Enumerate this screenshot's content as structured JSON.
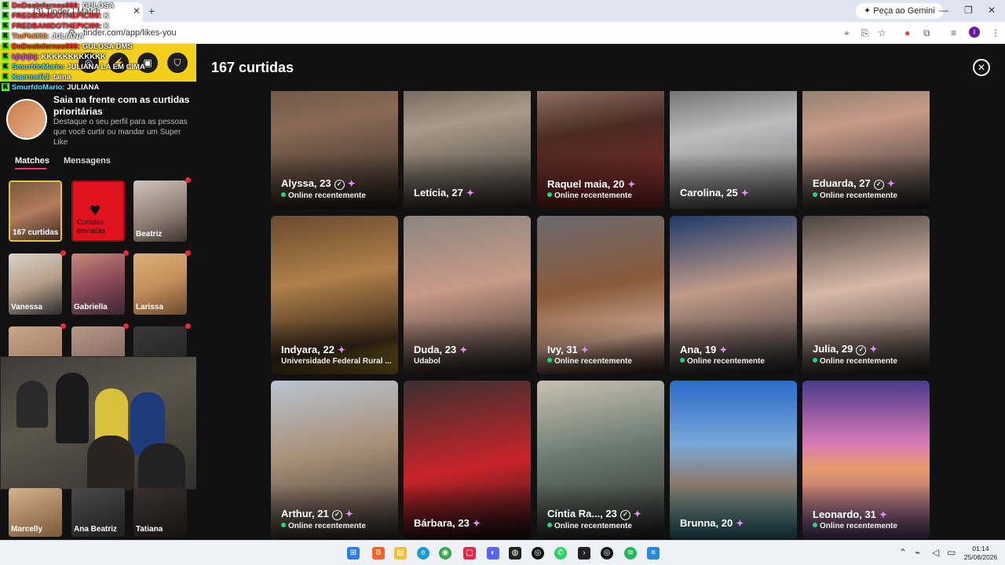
{
  "browser": {
    "tab_title": "(3) Tinder | Match",
    "url": "tinder.com/app/likes-you",
    "gemini_button": "Peça ao Gemini",
    "profile_initial": "I"
  },
  "chat": [
    {
      "user": "DnDosInfernos666:",
      "msg": "GULOSA",
      "color": "#ff2b2b"
    },
    {
      "user": "FREDBANIDOTHEPICI00:",
      "msg": "K",
      "color": "#ff2b2b"
    },
    {
      "user": "FREDBANIDOTHEPICI00:",
      "msg": "K",
      "color": "#ff2b2b"
    },
    {
      "user": "TioPhill33:",
      "msg": "JULIANA",
      "color": "#ff9a2b"
    },
    {
      "user": "DnDosInfernos666:",
      "msg": "GULOSA DMS",
      "color": "#ff2b2b"
    },
    {
      "user": "kjkjkjkj:",
      "msg": "KKKKKKKKKKKK",
      "color": "#d64bff"
    },
    {
      "user": "SmurfdoMario:",
      "msg": "JULIANA LA EM CIMA",
      "color": "#4fe3ff"
    },
    {
      "user": "KaermeRJ:",
      "msg": "taina",
      "color": "#4fe3ff"
    },
    {
      "user": "SmurfdoMario:",
      "msg": "JULIANA",
      "color": "#4fe3ff"
    }
  ],
  "sidebar": {
    "promo_title": "Saia na frente com as curtidas prioritárias",
    "promo_desc": "Destaque o seu perfil para as pessoas que você curtir ou mandar um Super Like",
    "tab_matches": "Matches",
    "tab_messages": "Mensagens",
    "cards": [
      {
        "label": "167 curtidas"
      },
      {
        "label": "Curtidas enviadas"
      },
      {
        "label": "Beatriz"
      },
      {
        "label": "Vanessa"
      },
      {
        "label": "Gabriella"
      },
      {
        "label": "Larissa"
      },
      {
        "label": ""
      },
      {
        "label": ""
      },
      {
        "label": ""
      },
      {
        "label": "Marcelly"
      },
      {
        "label": "Ana Beatriz"
      },
      {
        "label": "Tatiana"
      }
    ]
  },
  "main": {
    "title": "167 curtidas",
    "profiles": [
      {
        "name": "Alyssa, 23",
        "status": "Online recentemente"
      },
      {
        "name": "Letícia, 27",
        "status": ""
      },
      {
        "name": "Raquel maia, 20",
        "status": "Online recentemente"
      },
      {
        "name": "Carolina, 25",
        "status": ""
      },
      {
        "name": "Eduarda, 27",
        "status": "Online recentemente"
      },
      {
        "name": "Indyara, 22",
        "status": "Universidade Federal Rural ..."
      },
      {
        "name": "Duda, 23",
        "status": "Udabol"
      },
      {
        "name": "Ivy, 31",
        "status": "Online recentemente"
      },
      {
        "name": "Ana, 19",
        "status": "Online recentemente"
      },
      {
        "name": "Julia, 29",
        "status": "Online recentemente"
      },
      {
        "name": "Arthur, 21",
        "status": "Online recentemente"
      },
      {
        "name": "Bárbara, 23",
        "status": ""
      },
      {
        "name": "Cíntia Ra..., 23",
        "status": "Online recentemente"
      },
      {
        "name": "Brunna, 20",
        "status": ""
      },
      {
        "name": "Leonardo, 31",
        "status": "Online recentemente"
      }
    ]
  },
  "taskbar": {
    "time": "01:14",
    "date": "25/08/2026"
  }
}
